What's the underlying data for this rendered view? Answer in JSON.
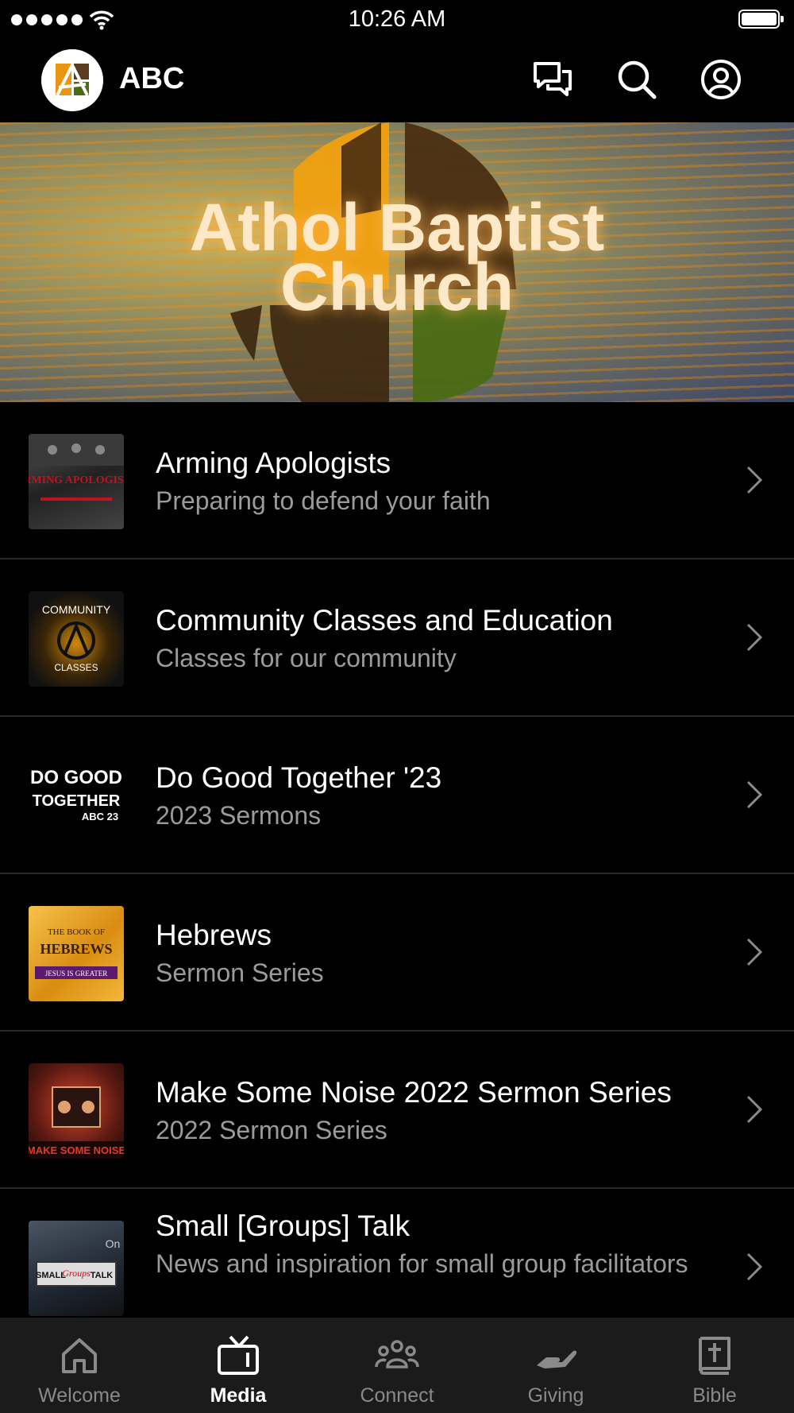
{
  "status_bar": {
    "time": "10:26 AM"
  },
  "header": {
    "brand": "ABC",
    "icons": [
      "chat-icon",
      "search-icon",
      "profile-icon"
    ]
  },
  "banner": {
    "line1": "Athol Baptist",
    "line2": "Church"
  },
  "list": [
    {
      "title": "Arming Apologists",
      "subtitle": "Preparing to defend your faith",
      "thumb_text": "ARMING APOLOGISTS"
    },
    {
      "title": "Community Classes and Education",
      "subtitle": "Classes for our community",
      "thumb_text_top": "COMMUNITY",
      "thumb_text_bottom": "CLASSES"
    },
    {
      "title": "Do Good Together '23",
      "subtitle": "2023 Sermons",
      "thumb_text_1": "DO GOOD",
      "thumb_text_2": "TOGETHER",
      "thumb_text_3": "ABC 23"
    },
    {
      "title": "Hebrews",
      "subtitle": "Sermon Series",
      "thumb_text_1": "THE BOOK OF",
      "thumb_text_2": "HEBREWS",
      "thumb_text_3": "JESUS IS GREATER"
    },
    {
      "title": "Make Some Noise 2022 Sermon Series",
      "subtitle": "2022 Sermon Series",
      "thumb_text": "MAKE SOME NOISE"
    },
    {
      "title": "Small [Groups] Talk",
      "subtitle": "News and inspiration for small group facilitators",
      "thumb_text_1": "SMALL",
      "thumb_text_2": "Groups",
      "thumb_text_3": "TALK",
      "thumb_text_4": "On"
    }
  ],
  "tabs": [
    {
      "label": "Welcome",
      "icon": "home-icon",
      "active": false
    },
    {
      "label": "Media",
      "icon": "tv-icon",
      "active": true
    },
    {
      "label": "Connect",
      "icon": "people-icon",
      "active": false
    },
    {
      "label": "Giving",
      "icon": "giving-hand-icon",
      "active": false
    },
    {
      "label": "Bible",
      "icon": "bible-icon",
      "active": false
    }
  ],
  "colors": {
    "background": "#000000",
    "tabbar": "#1b1b1b",
    "subtitle": "#9b9b9b",
    "separator": "#2a2a2a",
    "tab_inactive": "#8a8a8a"
  }
}
